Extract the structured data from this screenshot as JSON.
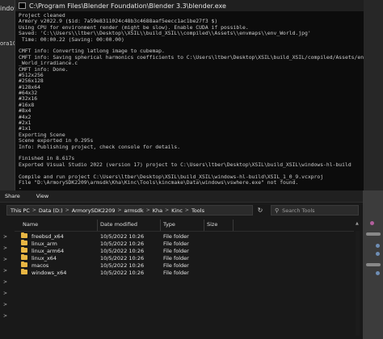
{
  "blender": {
    "menu_label": "indow",
    "side_label": "ora102"
  },
  "console": {
    "title": "C:\\Program Files\\Blender Foundation\\Blender 3.3\\blender.exe",
    "lines": [
      "Project cleaned",
      "Armory v2022.9 ($id: 7a59e8311024c48b3c4688aaf5eecc1ac1be27f3 $)",
      "Using CPU for environment render (might be slow). Enable CUDA if possible.",
      "Saved: 'C:\\\\Users\\\\ltber\\\\Desktop\\\\XSIL\\\\build_XSIL\\\\compiled\\\\Assets\\\\envmaps\\\\env_World.jpg'",
      " Time: 00:00.22 (Saving: 00:00.00)",
      "",
      "CMFT info: Converting latlong image to cubemap.",
      "CMFT info: Saving spherical harmonics coefficients to C:\\Users\\ltber\\Desktop\\XSIL\\build_XSIL/compiled/Assets/envmaps/env",
      "_World_irradiance.c",
      "CMFT info: Done.",
      "#512x256",
      "#256x128",
      "#128x64",
      "#64x32",
      "#32x16",
      "#16x8",
      "#8x4",
      "#4x2",
      "#2x1",
      "#1x1",
      "Exporting Scene",
      "Scene exported in 0.295s",
      "Info: Publishing project, check console for details.",
      "",
      "Finished in 8.617s",
      "Exported Visual Studio 2022 (version 17) project to C:\\Users\\ltber\\Desktop\\XSIL\\build_XSIL\\windows-hl-build",
      "",
      "Compile and run project C:\\Users\\ltber\\Desktop\\XSIL\\build_XSIL\\windows-hl-build\\XSIL_1_0_9.vcxproj",
      "File \"D:\\ArmorySDK2209\\armsdk\\Kha\\Kinc\\Tools\\kincmake\\Data\\windows\\vswhere.exe\" not found.",
      "-"
    ]
  },
  "explorer": {
    "ribbon": [
      "Share",
      "View"
    ],
    "breadcrumb": [
      "This PC",
      "Data (D:)",
      "ArmorySDK2209",
      "armsdk",
      "Kha",
      "Kinc",
      "Tools"
    ],
    "search_placeholder": "Search Tools",
    "columns": [
      "Name",
      "Date modified",
      "Type",
      "Size"
    ],
    "rows": [
      {
        "name": "freebsd_x64",
        "date": "10/5/2022 10:26",
        "type": "File folder",
        "size": ""
      },
      {
        "name": "linux_arm",
        "date": "10/5/2022 10:26",
        "type": "File folder",
        "size": ""
      },
      {
        "name": "linux_arm64",
        "date": "10/5/2022 10:26",
        "type": "File folder",
        "size": ""
      },
      {
        "name": "linux_x64",
        "date": "10/5/2022 10:26",
        "type": "File folder",
        "size": ""
      },
      {
        "name": "macos",
        "date": "10/5/2022 10:26",
        "type": "File folder",
        "size": ""
      },
      {
        "name": "windows_x64",
        "date": "10/5/2022 10:26",
        "type": "File folder",
        "size": ""
      }
    ]
  },
  "icons": {
    "folder": "folder-icon",
    "search": "search-icon",
    "refresh": "refresh-icon",
    "terminal": "terminal-icon",
    "chevron": "chevron-right-icon"
  },
  "colors": {
    "console_bg": "#0c0c0c",
    "console_text": "#cccccc",
    "folder": "#e8b643",
    "explorer_bg": "#191919"
  }
}
